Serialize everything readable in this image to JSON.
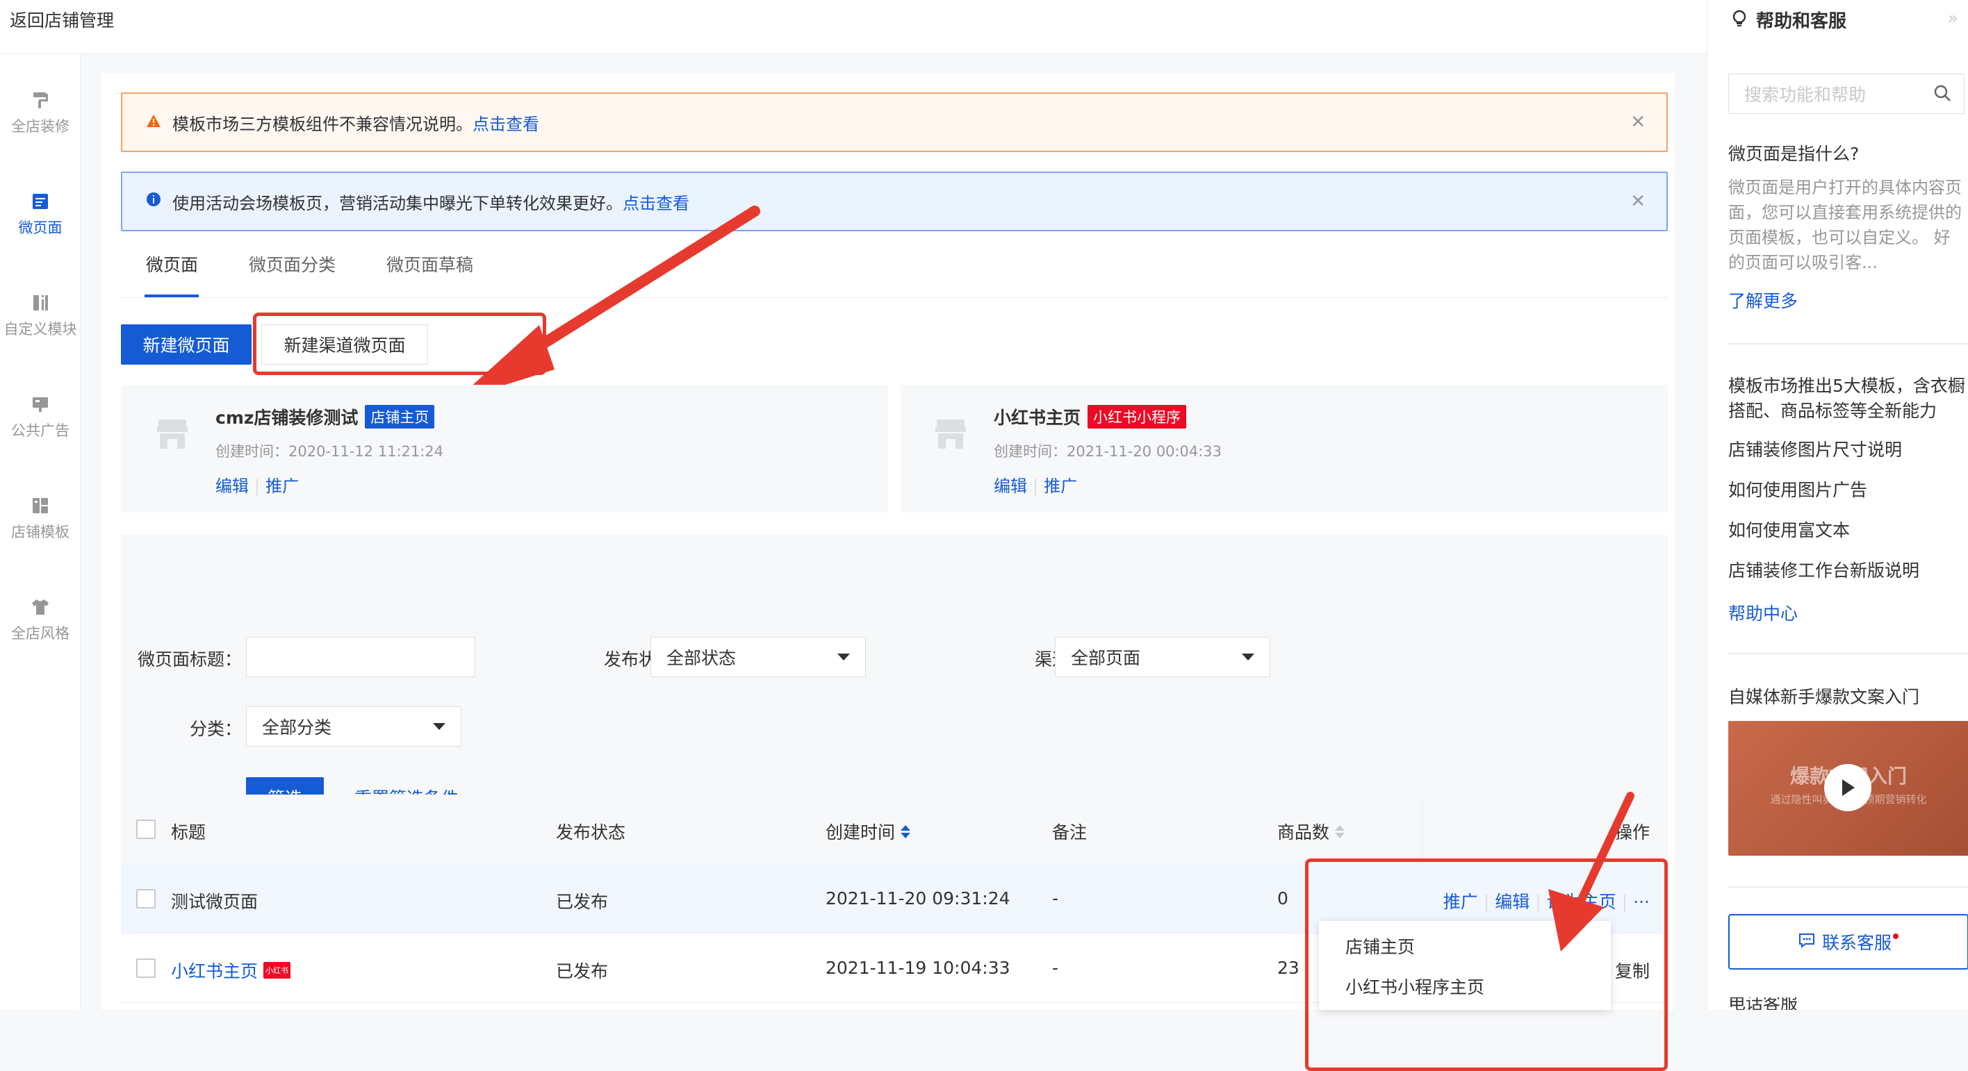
{
  "topbar": {
    "back_label": "返回店铺管理"
  },
  "leftnav": [
    {
      "label": "全店装修",
      "icon": "paint-roller-icon",
      "active": false
    },
    {
      "label": "微页面",
      "icon": "page-icon",
      "active": true
    },
    {
      "label": "自定义模块",
      "icon": "custom-module-icon",
      "active": false
    },
    {
      "label": "公共广告",
      "icon": "ad-icon",
      "active": false
    },
    {
      "label": "店铺模板",
      "icon": "template-icon",
      "active": false
    },
    {
      "label": "全店风格",
      "icon": "shirt-icon",
      "active": false
    }
  ],
  "notices": {
    "warning_text": "模板市场三方模板组件不兼容情况说明。",
    "warning_link": "点击查看",
    "info_text": "使用活动会场模板页，营销活动集中曝光下单转化效果更好。",
    "info_link": "点击查看"
  },
  "tabs": [
    "微页面",
    "微页面分类",
    "微页面草稿"
  ],
  "buttons": {
    "new_page": "新建微页面",
    "new_channel_page": "新建渠道微页面"
  },
  "home_cards": [
    {
      "title": "cmz店铺装修测试",
      "tag": "店铺主页",
      "tag_color": "#155bd4",
      "time": "创建时间：2020-11-12 11:21:24",
      "edit": "编辑",
      "promote": "推广"
    },
    {
      "title": "小红书主页",
      "tag": "小红书小程序",
      "tag_color": "#ee0a24",
      "time": "创建时间：2021-11-20 00:04:33",
      "edit": "编辑",
      "promote": "推广"
    }
  ],
  "filters": {
    "title_label": "微页面标题：",
    "title_value": "",
    "status_label": "发布状态：",
    "status_value": "全部状态",
    "channel_label": "渠道：",
    "channel_value": "全部页面",
    "category_label": "分类：",
    "category_value": "全部分类",
    "filter_button": "筛选",
    "reset_link": "重置筛选条件"
  },
  "table": {
    "headers": {
      "title": "标题",
      "status": "发布状态",
      "created": "创建时间",
      "note": "备注",
      "goods": "商品数",
      "ops": "操作"
    },
    "rows": [
      {
        "title": "测试微页面",
        "status": "已发布",
        "created": "2021-11-20 09:31:24",
        "note": "-",
        "goods": "0",
        "ops": [
          "推广",
          "编辑",
          "设为主页",
          "···"
        ]
      },
      {
        "title": "小红书主页",
        "badge": "小红书",
        "status": "已发布",
        "created": "2021-11-19 10:04:33",
        "note": "-",
        "goods": "23",
        "ops_visible": "复制"
      }
    ]
  },
  "dropdown": [
    "店铺主页",
    "小红书小程序主页"
  ],
  "right_panel": {
    "title": "帮助和客服",
    "search_placeholder": "搜索功能和帮助",
    "q_title": "微页面是指什么?",
    "q_body": "微页面是用户打开的具体内容页面，您可以直接套用系统提供的页面模板，也可以自定义。 好的页面可以吸引客...",
    "learn_more": "了解更多",
    "articles": [
      "模板市场推出5大模板，含衣橱搭配、商品标签等全新能力",
      "店铺装修图片尺寸说明",
      "如何使用图片广告",
      "如何使用富文本",
      "店铺装修工作台新版说明"
    ],
    "help_center": "帮助中心",
    "video_title": "自媒体新手爆款文案入门",
    "video_caption": "爆款文案入门",
    "video_sub": "通过隐性叫卖，达到预期营销转化",
    "contact_button": "联系客服",
    "phone_label": "电话客服"
  }
}
